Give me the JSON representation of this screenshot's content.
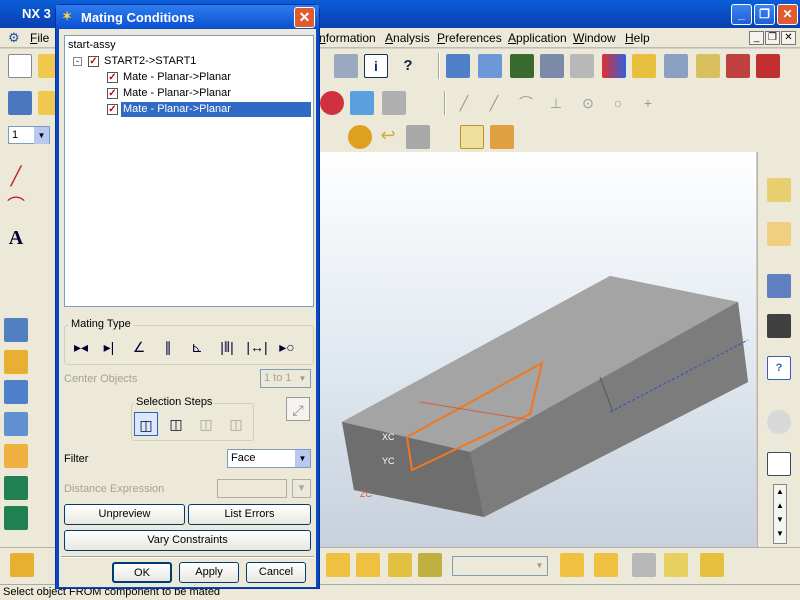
{
  "app": {
    "title": "NX 3"
  },
  "menubar": {
    "items": [
      "File",
      "nformation",
      "Analysis",
      "Preferences",
      "Application",
      "Window",
      "Help"
    ]
  },
  "toolbar": {
    "layer_value": "1"
  },
  "dialog": {
    "title": "Mating Conditions",
    "tree": {
      "root": "start-assy",
      "node": "START2->START1",
      "children": [
        "Mate - Planar->Planar",
        "Mate - Planar->Planar",
        "Mate - Planar->Planar"
      ]
    },
    "mating_type_label": "Mating Type",
    "center_objects_label": "Center Objects",
    "center_objects_value": "1 to 1",
    "selection_steps_label": "Selection Steps",
    "filter_label": "Filter",
    "filter_value": "Face",
    "distance_expression_label": "Distance Expression",
    "unpreview_label": "Unpreview",
    "list_errors_label": "List Errors",
    "vary_constraints_label": "Vary Constraints",
    "ok_label": "OK",
    "apply_label": "Apply",
    "cancel_label": "Cancel"
  },
  "graphics": {
    "axis_xc": "XC",
    "axis_yc": "YC",
    "axis_zc": "ZC"
  },
  "status": {
    "prompt": "Select object FROM component to be mated"
  },
  "colors": {
    "titlebar": "#0a4ac0",
    "selection": "#316ac5",
    "model": "#9a9a9a",
    "highlight": "#f07820"
  }
}
